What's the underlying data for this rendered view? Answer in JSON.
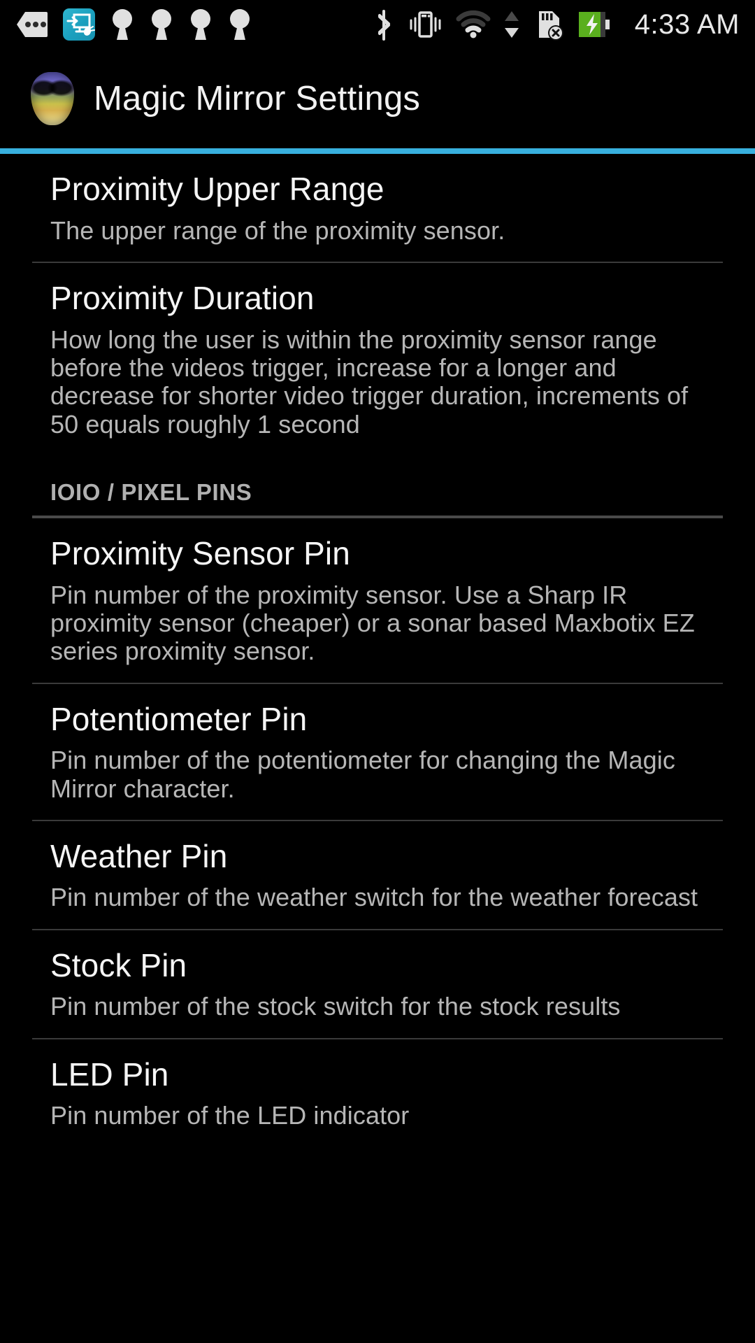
{
  "status_bar": {
    "time": "4:33 AM",
    "left_icons": [
      {
        "name": "more-notifications-icon",
        "label": "more"
      },
      {
        "name": "screen-cast-app-icon",
        "label": "cast"
      },
      {
        "name": "notification-icon-1",
        "label": "notification"
      },
      {
        "name": "notification-icon-2",
        "label": "notification"
      },
      {
        "name": "notification-icon-3",
        "label": "notification"
      },
      {
        "name": "notification-icon-4",
        "label": "notification"
      }
    ],
    "right_icons": [
      {
        "name": "bluetooth-icon",
        "label": "bluetooth"
      },
      {
        "name": "vibrate-icon",
        "label": "vibrate"
      },
      {
        "name": "wifi-icon",
        "label": "wifi"
      },
      {
        "name": "data-transfer-icon",
        "label": "data up down"
      },
      {
        "name": "sd-card-removed-icon",
        "label": "sd card removed"
      },
      {
        "name": "battery-charging-icon",
        "label": "battery charging"
      }
    ],
    "battery_color": "#5aaf1e"
  },
  "action_bar": {
    "title": "Magic Mirror Settings",
    "icon_name": "magic-mirror-mask-icon",
    "accent_color": "#38b0de"
  },
  "preferences": [
    {
      "title": "Proximity Upper Range",
      "summary": "The upper range of the proximity sensor."
    },
    {
      "title": "Proximity Duration",
      "summary": "How long the user is within the proximity sensor range before the videos trigger, increase for a longer and decrease for shorter video trigger duration, increments of 50 equals roughly 1 second"
    }
  ],
  "section": {
    "label": "IOIO / PIXEL PINS"
  },
  "pin_preferences": [
    {
      "title": "Proximity Sensor Pin",
      "summary": "Pin number of the proximity sensor. Use a Sharp IR proximity sensor (cheaper) or a sonar based Maxbotix EZ series proximity sensor."
    },
    {
      "title": "Potentiometer Pin",
      "summary": "Pin number of the potentiometer for changing the Magic Mirror character."
    },
    {
      "title": "Weather Pin",
      "summary": "Pin number of the weather switch for the weather forecast"
    },
    {
      "title": "Stock Pin",
      "summary": "Pin number of the stock switch for the stock results"
    },
    {
      "title": "LED Pin",
      "summary": "Pin number of the LED indicator"
    }
  ]
}
